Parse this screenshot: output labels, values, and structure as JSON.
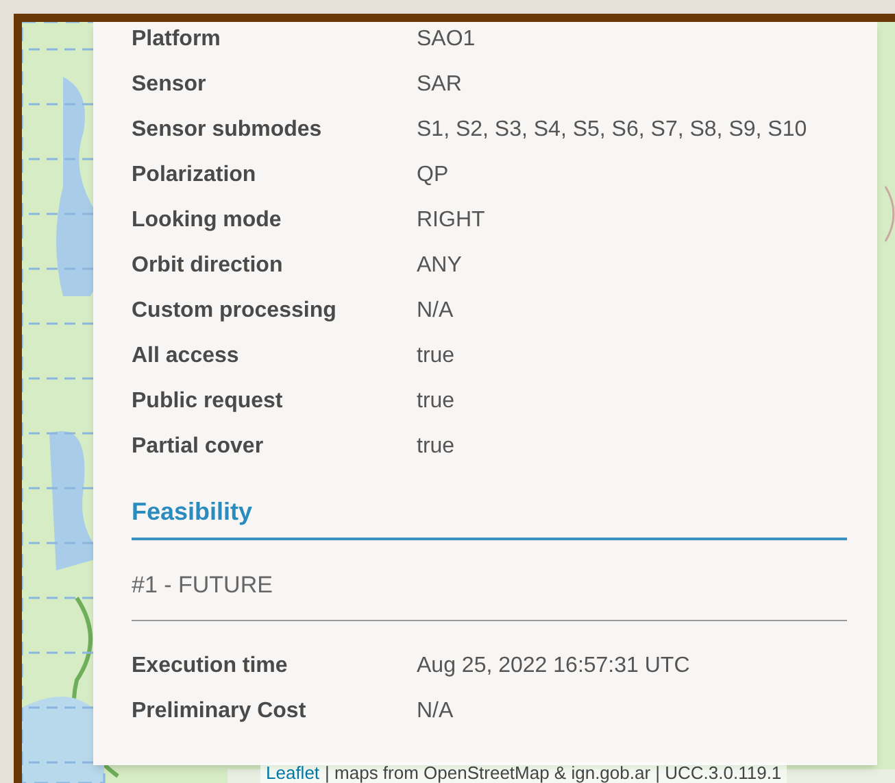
{
  "details": [
    {
      "label": "Platform",
      "value": "SAO1"
    },
    {
      "label": "Sensor",
      "value": "SAR"
    },
    {
      "label": "Sensor submodes",
      "value": "S1, S2, S3, S4, S5, S6, S7, S8, S9, S10"
    },
    {
      "label": "Polarization",
      "value": "QP"
    },
    {
      "label": "Looking mode",
      "value": "RIGHT"
    },
    {
      "label": "Orbit direction",
      "value": "ANY"
    },
    {
      "label": "Custom processing",
      "value": "N/A"
    },
    {
      "label": "All access",
      "value": "true"
    },
    {
      "label": "Public request",
      "value": "true"
    },
    {
      "label": "Partial cover",
      "value": "true"
    }
  ],
  "feasibility": {
    "title": "Feasibility",
    "option": "#1 - FUTURE",
    "details": [
      {
        "label": "Execution time",
        "value": "Aug 25, 2022 16:57:31 UTC"
      },
      {
        "label": "Preliminary Cost",
        "value": "N/A"
      }
    ]
  },
  "attribution": {
    "link": "Leaflet",
    "text": "| maps from OpenStreetMap & ign.gob.ar | UCC.3.0.119.1"
  }
}
